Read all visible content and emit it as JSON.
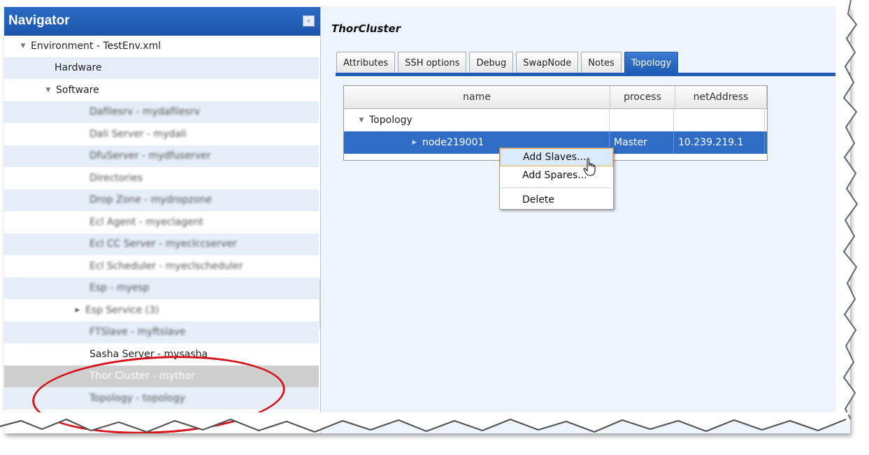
{
  "navigator": {
    "title": "Navigator",
    "collapse_icon": "‹",
    "tree": {
      "environment_label": "Environment - TestEnv.xml",
      "hardware_label": "Hardware",
      "software_label": "Software",
      "blurred_items": [
        "Dafilesrv - mydafilesrv",
        "Dali Server - mydali",
        "DfuServer - mydfuserver",
        "Directories",
        "Drop Zone - mydropzone",
        "Ecl Agent - myeclagent",
        "Ecl CC Server - myeclccserver",
        "Ecl Scheduler - myeclscheduler",
        "Esp - myesp",
        "Esp Service (3)",
        "FTSlave - myftslave"
      ],
      "sasha_label": "Sasha Server - mysasha",
      "thor_label": "Thor Cluster - mythor",
      "topology_label": "Topology - topology"
    }
  },
  "main": {
    "title": "ThorCluster",
    "tabs": [
      "Attributes",
      "SSH options",
      "Debug",
      "SwapNode",
      "Notes",
      "Topology"
    ],
    "active_tab": "Topology",
    "grid": {
      "columns": [
        "name",
        "process",
        "netAddress"
      ],
      "root_label": "Topology",
      "node": {
        "name": "node219001",
        "process": "Master",
        "netAddress": "10.239.219.1"
      }
    }
  },
  "context_menu": {
    "items": [
      "Add Slaves...",
      "Add Spares...",
      "Delete"
    ],
    "highlighted": "Add Slaves..."
  },
  "colors": {
    "accent": "#1f5cb5",
    "selection": "#2f6cc6",
    "annotation": "#d6141b"
  }
}
